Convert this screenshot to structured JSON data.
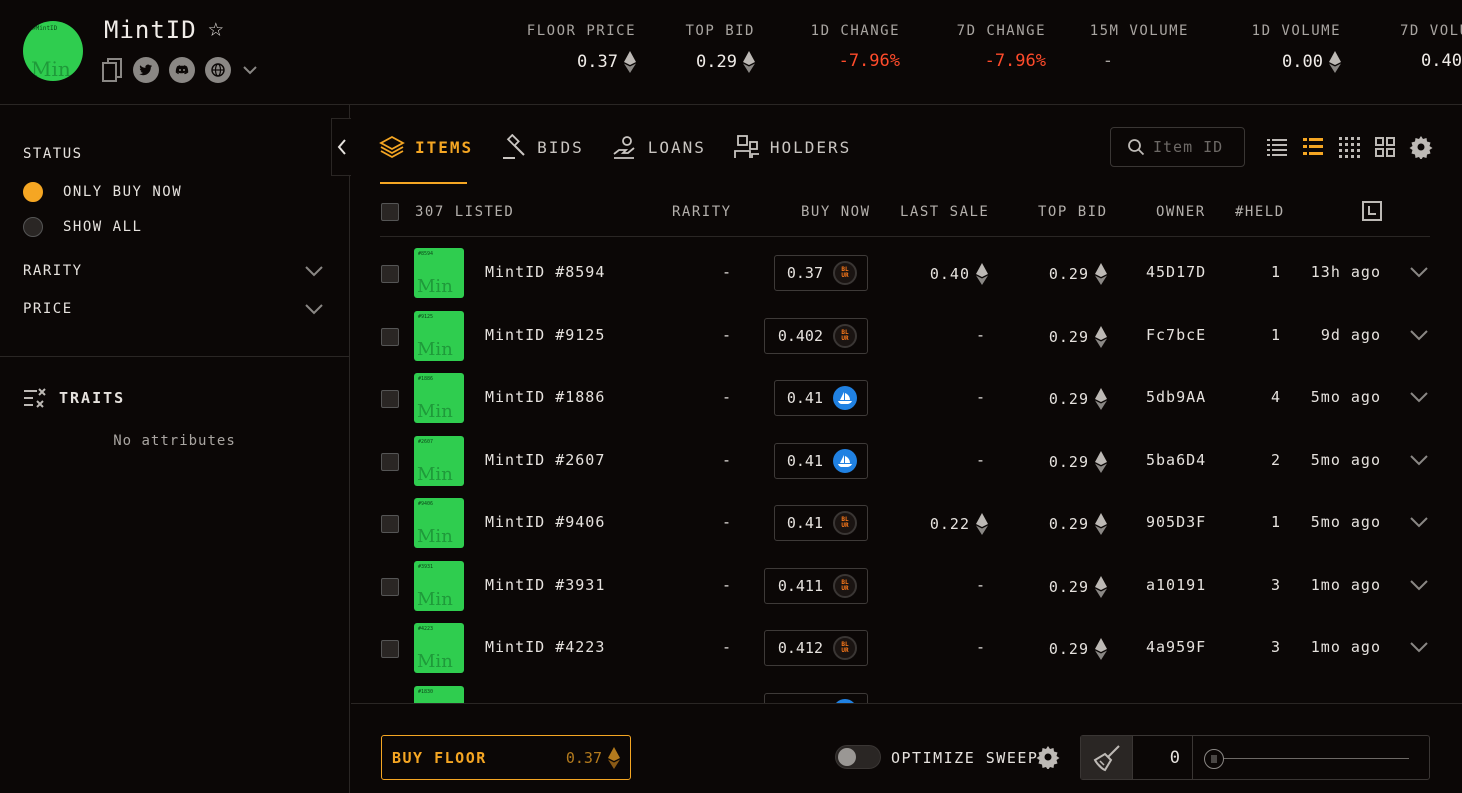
{
  "collection": {
    "name": "MintID",
    "logo_text_small": "#MintID",
    "logo_text_big": "Min"
  },
  "stats": [
    {
      "label": "FLOOR PRICE",
      "value": "0.37",
      "eth": true,
      "negative": false
    },
    {
      "label": "TOP BID",
      "value": "0.29",
      "eth": true,
      "negative": false
    },
    {
      "label": "1D CHANGE",
      "value": "-7.96%",
      "eth": false,
      "negative": true
    },
    {
      "label": "7D CHANGE",
      "value": "-7.96%",
      "eth": false,
      "negative": true
    },
    {
      "label": "15M VOLUME",
      "value": "-",
      "eth": false,
      "negative": false
    },
    {
      "label": "1D VOLUME",
      "value": "0.00",
      "eth": true,
      "negative": false
    },
    {
      "label": "7D VOLU",
      "value": "0.40",
      "eth": false,
      "negative": false
    }
  ],
  "sidebar": {
    "status_heading": "STATUS",
    "status_options": [
      {
        "label": "ONLY BUY NOW",
        "selected": true
      },
      {
        "label": "SHOW ALL",
        "selected": false
      }
    ],
    "filters": [
      "RARITY",
      "PRICE"
    ],
    "traits_heading": "TRAITS",
    "no_attributes": "No attributes"
  },
  "tabs": [
    {
      "label": "ITEMS",
      "active": true,
      "icon": "layers-icon"
    },
    {
      "label": "BIDS",
      "active": false,
      "icon": "gavel-icon"
    },
    {
      "label": "LOANS",
      "active": false,
      "icon": "loan-hand-icon"
    },
    {
      "label": "HOLDERS",
      "active": false,
      "icon": "users-icon"
    }
  ],
  "search": {
    "placeholder": "Item ID"
  },
  "table": {
    "columns": {
      "listed": "307 LISTED",
      "rarity": "RARITY",
      "buy_now": "BUY NOW",
      "last_sale": "LAST SALE",
      "top_bid": "TOP BID",
      "owner": "OWNER",
      "held": "#HELD"
    },
    "rows": [
      {
        "name": "MintID #8594",
        "thumb_label": "#8594",
        "rarity": "-",
        "buy_now": "0.37",
        "market": "blur",
        "last_sale": "0.40",
        "top_bid": "0.29",
        "owner": "45D17D",
        "held": "1",
        "time": "13h ago"
      },
      {
        "name": "MintID #9125",
        "thumb_label": "#9125",
        "rarity": "-",
        "buy_now": "0.402",
        "market": "blur",
        "last_sale": "-",
        "top_bid": "0.29",
        "owner": "Fc7bcE",
        "held": "1",
        "time": "9d ago"
      },
      {
        "name": "MintID #1886",
        "thumb_label": "#1886",
        "rarity": "-",
        "buy_now": "0.41",
        "market": "opensea",
        "last_sale": "-",
        "top_bid": "0.29",
        "owner": "5db9AA",
        "held": "4",
        "time": "5mo ago"
      },
      {
        "name": "MintID #2607",
        "thumb_label": "#2607",
        "rarity": "-",
        "buy_now": "0.41",
        "market": "opensea",
        "last_sale": "-",
        "top_bid": "0.29",
        "owner": "5ba6D4",
        "held": "2",
        "time": "5mo ago"
      },
      {
        "name": "MintID #9406",
        "thumb_label": "#9406",
        "rarity": "-",
        "buy_now": "0.41",
        "market": "blur",
        "last_sale": "0.22",
        "top_bid": "0.29",
        "owner": "905D3F",
        "held": "1",
        "time": "5mo ago"
      },
      {
        "name": "MintID #3931",
        "thumb_label": "#3931",
        "rarity": "-",
        "buy_now": "0.411",
        "market": "blur",
        "last_sale": "-",
        "top_bid": "0.29",
        "owner": "a10191",
        "held": "3",
        "time": "1mo ago"
      },
      {
        "name": "MintID #4223",
        "thumb_label": "#4223",
        "rarity": "-",
        "buy_now": "0.412",
        "market": "blur",
        "last_sale": "-",
        "top_bid": "0.29",
        "owner": "4a959F",
        "held": "3",
        "time": "1mo ago"
      },
      {
        "name": "",
        "thumb_label": "#1830",
        "rarity": "",
        "buy_now": "",
        "market": "opensea",
        "last_sale": "",
        "top_bid": "",
        "owner": "",
        "held": "",
        "time": ""
      }
    ]
  },
  "footer": {
    "buy_floor_label": "BUY FLOOR",
    "buy_floor_value": "0.37",
    "optimize_label": "OPTIMIZE SWEEP",
    "sweep_count": "0"
  },
  "colors": {
    "accent": "#f5a623",
    "negative": "#ff4b2b",
    "nft_green": "#2fcd4f"
  }
}
